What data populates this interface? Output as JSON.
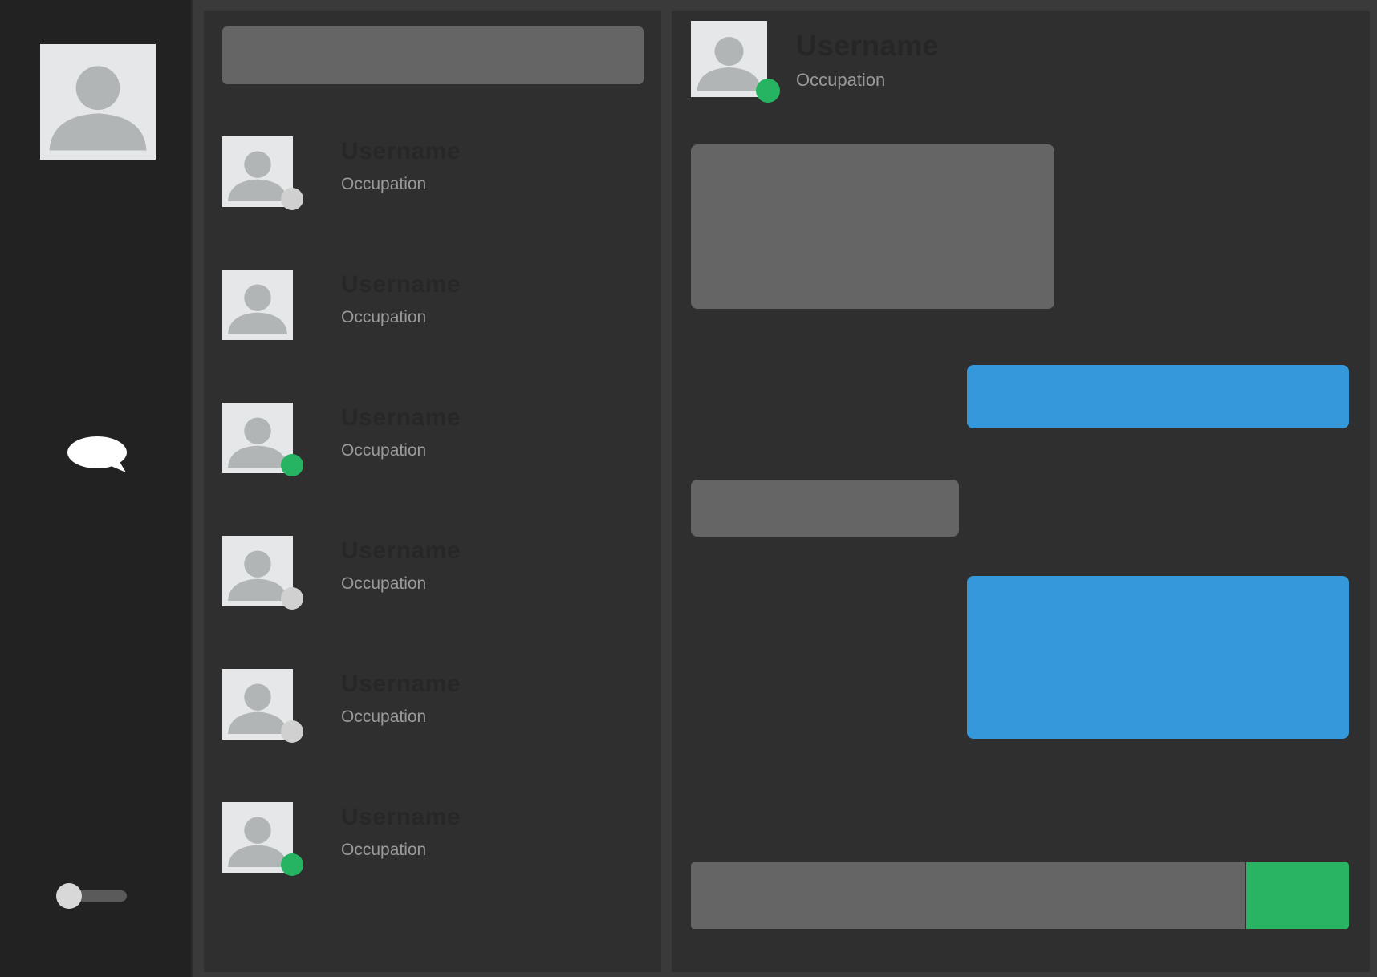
{
  "colors": {
    "online": "#27b462",
    "offline": "#d0d0d0",
    "outgoing_bubble": "#3498db",
    "incoming_bubble": "#656565",
    "send_button": "#28b463"
  },
  "sidebar": {
    "profile_icon": "user-avatar-icon",
    "nav_icon": "chat-bubble-icon",
    "toggle_icon": "theme-toggle"
  },
  "contacts": {
    "search": {
      "placeholder": "",
      "value": ""
    },
    "items": [
      {
        "name": "Username",
        "occupation": "Occupation",
        "status": "offline"
      },
      {
        "name": "Username",
        "occupation": "Occupation",
        "status": "none"
      },
      {
        "name": "Username",
        "occupation": "Occupation",
        "status": "online"
      },
      {
        "name": "Username",
        "occupation": "Occupation",
        "status": "offline"
      },
      {
        "name": "Username",
        "occupation": "Occupation",
        "status": "offline"
      },
      {
        "name": "Username",
        "occupation": "Occupation",
        "status": "online"
      }
    ]
  },
  "conversation": {
    "header": {
      "name": "Username",
      "occupation": "Occupation",
      "status": "online"
    },
    "messages": [
      {
        "direction": "incoming",
        "text": ""
      },
      {
        "direction": "outgoing",
        "text": ""
      },
      {
        "direction": "incoming",
        "text": ""
      },
      {
        "direction": "outgoing",
        "text": ""
      }
    ],
    "composer": {
      "placeholder": "",
      "value": "",
      "send_label": ""
    }
  }
}
